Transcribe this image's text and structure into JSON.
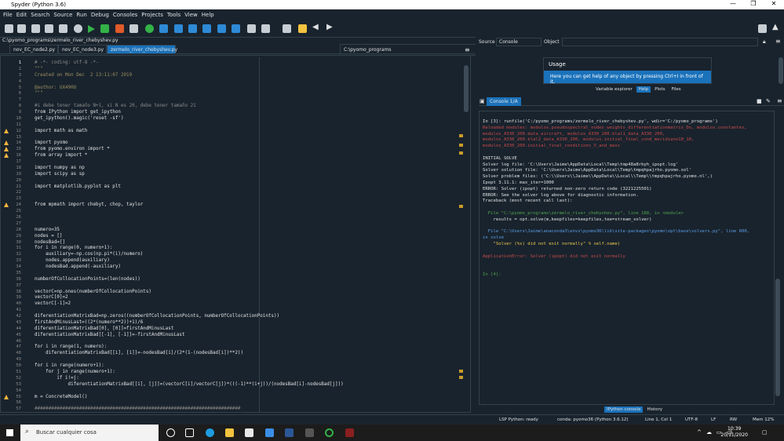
{
  "window": {
    "title": "Spyder (Python 3.6)",
    "controls": [
      "—",
      "❐",
      "✕"
    ]
  },
  "menu": [
    "File",
    "Edit",
    "Search",
    "Source",
    "Run",
    "Debug",
    "Consoles",
    "Projects",
    "Tools",
    "View",
    "Help"
  ],
  "toolbar": {
    "path": "C:\\pyomo_programs"
  },
  "editor": {
    "filepath": "C:\\pyomo_programs\\zermelo_river_chebyshev.py",
    "tabs": [
      "nov_EC_node2.py",
      "nov_EC_node3.py",
      "zermelo_river_chebyshev.py"
    ],
    "active_tab": 2,
    "lines": [
      {
        "n": "1",
        "t": "# -*- coding: utf-8 -*-",
        "c": "#8a8a8a"
      },
      {
        "n": "2",
        "t": "\"\"\"",
        "c": "#9b8f5f"
      },
      {
        "n": "3",
        "t": "Created on Mon Dec  2 13:11:07 2019",
        "c": "#9b8f5f"
      },
      {
        "n": "4",
        "t": "",
        "c": "#e0e1e3"
      },
      {
        "n": "5",
        "t": "@author: UX490U",
        "c": "#9b8f5f"
      },
      {
        "n": "6",
        "t": "\"\"\"",
        "c": "#9b8f5f"
      },
      {
        "n": "7",
        "t": "",
        "c": "#e0e1e3"
      },
      {
        "n": "8",
        "t": "#i debe tener tamaño N+1, si N es 20, debe tener tamaño 21",
        "c": "#8a8a8a"
      },
      {
        "n": "9",
        "t": "from IPython import get_ipython",
        "c": "#e0e1e3"
      },
      {
        "n": "10",
        "t": "get_ipython().magic('reset -sf')",
        "c": "#e0e1e3"
      },
      {
        "n": "11",
        "t": "",
        "c": "#e0e1e3"
      },
      {
        "n": "12",
        "t": "import math as math",
        "c": "#e0e1e3",
        "w": true
      },
      {
        "n": "13",
        "t": "",
        "c": "#e0e1e3"
      },
      {
        "n": "14",
        "t": "import pyomo",
        "c": "#e0e1e3",
        "w": true
      },
      {
        "n": "15",
        "t": "from pyomo.environ import *",
        "c": "#e0e1e3",
        "w": true
      },
      {
        "n": "16",
        "t": "from array import *",
        "c": "#e0e1e3",
        "w": true
      },
      {
        "n": "17",
        "t": "",
        "c": "#e0e1e3"
      },
      {
        "n": "18",
        "t": "import numpy as np",
        "c": "#e0e1e3"
      },
      {
        "n": "19",
        "t": "import scipy as sp",
        "c": "#e0e1e3"
      },
      {
        "n": "20",
        "t": "",
        "c": "#e0e1e3"
      },
      {
        "n": "21",
        "t": "import matplotlib.pyplot as plt",
        "c": "#e0e1e3"
      },
      {
        "n": "22",
        "t": "",
        "c": "#e0e1e3"
      },
      {
        "n": "23",
        "t": "",
        "c": "#e0e1e3"
      },
      {
        "n": "24",
        "t": "from mpmath import chebyt, chop, taylor",
        "c": "#e0e1e3",
        "w": true
      },
      {
        "n": "25",
        "t": "",
        "c": "#e0e1e3"
      },
      {
        "n": "26",
        "t": "",
        "c": "#e0e1e3"
      },
      {
        "n": "27",
        "t": "",
        "c": "#e0e1e3"
      },
      {
        "n": "28",
        "t": "numero=35",
        "c": "#e0e1e3"
      },
      {
        "n": "29",
        "t": "nodes = []",
        "c": "#e0e1e3"
      },
      {
        "n": "30",
        "t": "nodesBad=[]",
        "c": "#e0e1e3"
      },
      {
        "n": "31",
        "t": "for i in range(0, numero+1):",
        "c": "#e0e1e3"
      },
      {
        "n": "32",
        "t": "    auxiliary=-np.cos(np.pi*(i)/numero)",
        "c": "#e0e1e3"
      },
      {
        "n": "33",
        "t": "    nodes.append(auxiliary)",
        "c": "#e0e1e3"
      },
      {
        "n": "34",
        "t": "    nodesBad.append(-auxiliary)",
        "c": "#e0e1e3"
      },
      {
        "n": "35",
        "t": "",
        "c": "#e0e1e3"
      },
      {
        "n": "36",
        "t": "numberOfCollocationPoints=(len(nodes))",
        "c": "#e0e1e3"
      },
      {
        "n": "37",
        "t": "",
        "c": "#e0e1e3"
      },
      {
        "n": "38",
        "t": "vectorC=np.ones(numberOfCollocationPoints)",
        "c": "#e0e1e3"
      },
      {
        "n": "39",
        "t": "vectorC[0]=2",
        "c": "#e0e1e3"
      },
      {
        "n": "40",
        "t": "vectorC[-1]=2",
        "c": "#e0e1e3"
      },
      {
        "n": "41",
        "t": "",
        "c": "#e0e1e3"
      },
      {
        "n": "42",
        "t": "diferentiationMatrixBad=np.zeros((numberOfCollocationPoints, numberOfCollocationPoints))",
        "c": "#e0e1e3"
      },
      {
        "n": "43",
        "t": "firstAndMinusLast=((2*(numero**2))+1)/6",
        "c": "#e0e1e3"
      },
      {
        "n": "44",
        "t": "diferentiationMatrixBad[0], [0]]=firstAndMinusLast",
        "c": "#e0e1e3"
      },
      {
        "n": "45",
        "t": "diferentiationMatrixBad[[-1], [-1]]=-firstAndMinusLast",
        "c": "#e0e1e3"
      },
      {
        "n": "46",
        "t": "",
        "c": "#e0e1e3"
      },
      {
        "n": "47",
        "t": "for i in range(1, numero):",
        "c": "#e0e1e3"
      },
      {
        "n": "48",
        "t": "    diferentiationMatrixBad[[i], [i]]=-nodesBad[i]/(2*(1-(nodesBad[i])**2))",
        "c": "#e0e1e3"
      },
      {
        "n": "49",
        "t": "",
        "c": "#e0e1e3"
      },
      {
        "n": "50",
        "t": "for i in range(numero+1):",
        "c": "#e0e1e3"
      },
      {
        "n": "51",
        "t": "    for j in range(numero+1):",
        "c": "#e0e1e3"
      },
      {
        "n": "52",
        "t": "        if i!=j:",
        "c": "#e0e1e3"
      },
      {
        "n": "53",
        "t": "            diferentiationMatrixBad[[i], [j]]=(vectorC[i]/vectorC[j])*(((-1)**(i+j))/(nodesBad[i]-nodesBad[j]))",
        "c": "#e0e1e3"
      },
      {
        "n": "54",
        "t": "",
        "c": "#e0e1e3"
      },
      {
        "n": "55",
        "t": "m = ConcreteModel()",
        "c": "#e0e1e3",
        "w": true
      },
      {
        "n": "56",
        "t": "",
        "c": "#e0e1e3"
      },
      {
        "n": "57",
        "t": "##########################################################################",
        "c": "#8a8a8a"
      }
    ]
  },
  "help": {
    "source_label": "Source",
    "source_value": "Console",
    "object_label": "Object",
    "usage_title": "Usage",
    "usage_text": "Here you can get help of any object by pressing Ctrl+I in front of it,",
    "tabs": [
      "Variable explorer",
      "Help",
      "Plots",
      "Files"
    ],
    "active_tab": 1
  },
  "console": {
    "tab": "Console 1/A",
    "lines": [
      {
        "t": "In [3]: runfile('C:/pyomo_programs/zermelo_river_chebyshev.py', wdir='C:/pyomo_programs')",
        "c": "#e0e1e3"
      },
      {
        "t": "Reloaded modules: modulos.pseudospectral_nodes_weights_differentiationmatrix_Do, modulos.constantes,",
        "c": "#c84a4a"
      },
      {
        "t": "modulos_A330_200.data_aircraft, modulos_A330_200.klal1_data_A330_200,",
        "c": "#c84a4a"
      },
      {
        "t": "modulos_A330_200.klal2_data_A330_200, modulos.initial_final_cond_meridiano10_10,",
        "c": "#c84a4a"
      },
      {
        "t": "modulos_A330_200.initial_final_conditions_V_and_mass",
        "c": "#c84a4a"
      },
      {
        "t": "",
        "c": "#e0e1e3"
      },
      {
        "t": "INITIAL SOLVE",
        "c": "#e0e1e3"
      },
      {
        "t": "Solver log file: 'C:\\Users\\Jaime\\AppData\\Local\\Temp\\tmp48a8rbyh_ipopt.log'",
        "c": "#e0e1e3"
      },
      {
        "t": "Solver solution file: 'C:\\Users\\Jaime\\AppData\\Local\\Temp\\tmpqhpajrho.pyomo.sol'",
        "c": "#e0e1e3"
      },
      {
        "t": "Solver problem files: ('C:\\\\Users\\\\Jaime\\\\AppData\\\\Local\\\\Temp\\\\tmpqhpajrho.pyomo.nl',)",
        "c": "#e0e1e3"
      },
      {
        "t": "Ipopt 3.11.1: max_iter=1000",
        "c": "#e0e1e3"
      },
      {
        "t": "ERROR: Solver (ipopt) returned non-zero return code (3221225501)",
        "c": "#e0e1e3"
      },
      {
        "t": "ERROR: See the solver log above for diagnostic information.",
        "c": "#e0e1e3"
      },
      {
        "t": "Traceback (most recent call last):",
        "c": "#e0e1e3"
      },
      {
        "t": "",
        "c": "#e0e1e3"
      },
      {
        "t": "  File \"C:\\pyomo_programs\\zermelo_river_chebyshev.py\", line 188, in <module>",
        "c": "#4fa34f"
      },
      {
        "t": "    results = opt.solve(m,keepfiles=keepfiles,tee=stream_solver)",
        "c": "#e0e1e3"
      },
      {
        "t": "",
        "c": "#e0e1e3"
      },
      {
        "t": "  File \"C:\\Users\\Jaime\\anaconda3\\envs\\pyomo36\\lib\\site-packages\\pyomo\\opt\\base\\solvers.py\", line 600,",
        "c": "#5a9ee8"
      },
      {
        "t": "in solve",
        "c": "#5a9ee8"
      },
      {
        "t": "    \"Solver (%s) did not exit normally\" % self.name)",
        "c": "#e8c64f"
      },
      {
        "t": "",
        "c": "#e0e1e3"
      },
      {
        "t": "ApplicationError: Solver (ipopt) did not exit normally",
        "c": "#c84a4a"
      },
      {
        "t": "",
        "c": "#e0e1e3"
      },
      {
        "t": "",
        "c": "#e0e1e3"
      },
      {
        "t": "In [4]:",
        "c": "#4fa34f"
      }
    ],
    "bottom_tabs": [
      "IPython console",
      "History"
    ],
    "active_bottom": 0
  },
  "status": {
    "lsp": "LSP Python: ready",
    "conda": "conda: pyomo36 (Python 3.6.12)",
    "pos": "Line 1, Col 1",
    "enc": "UTF-8",
    "eol": "LF",
    "rw": "RW",
    "mem": "Mem 12%"
  },
  "taskbar": {
    "search_placeholder": "Buscar cualquier cosa",
    "time": "10:39",
    "date": "20/11/2020"
  },
  "colors": {
    "bg": "#19232d",
    "accent": "#1a72bb",
    "border": "#32414b",
    "warning": "#f3b53f"
  }
}
